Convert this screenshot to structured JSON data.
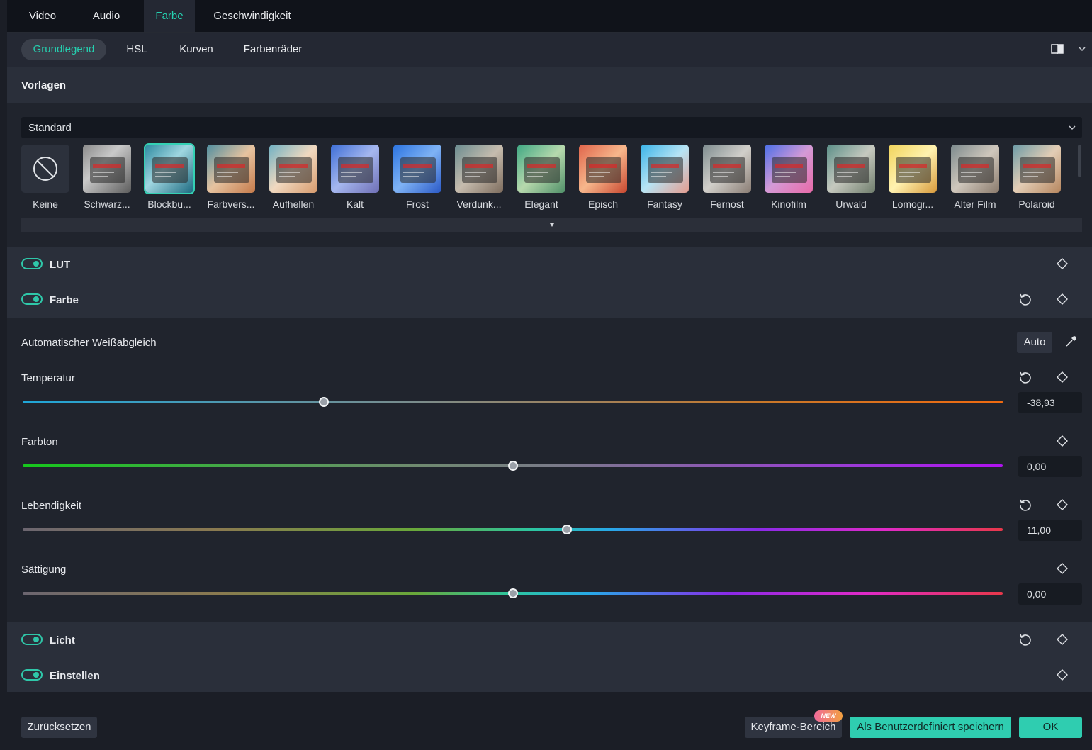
{
  "top_tabs": [
    {
      "label": "Video"
    },
    {
      "label": "Audio"
    },
    {
      "label": "Farbe"
    },
    {
      "label": "Geschwindigkeit"
    }
  ],
  "sub_tabs": [
    {
      "label": "Grundlegend"
    },
    {
      "label": "HSL"
    },
    {
      "label": "Kurven"
    },
    {
      "label": "Farbenräder"
    }
  ],
  "presets_section": {
    "title": "Vorlagen",
    "dropdown_value": "Standard",
    "items": [
      {
        "label": "Keine"
      },
      {
        "label": "Schwarz..."
      },
      {
        "label": "Blockbu..."
      },
      {
        "label": "Farbvers..."
      },
      {
        "label": "Aufhellen"
      },
      {
        "label": "Kalt"
      },
      {
        "label": "Frost"
      },
      {
        "label": "Verdunk..."
      },
      {
        "label": "Elegant"
      },
      {
        "label": "Episch"
      },
      {
        "label": "Fantasy"
      },
      {
        "label": "Fernost"
      },
      {
        "label": "Kinofilm"
      },
      {
        "label": "Urwald"
      },
      {
        "label": "Lomogr..."
      },
      {
        "label": "Alter Film"
      },
      {
        "label": "Polaroid"
      }
    ],
    "selected": "Blockbu..."
  },
  "lut": {
    "label": "LUT",
    "enabled": true
  },
  "color": {
    "label": "Farbe",
    "enabled": true,
    "white_balance_label": "Automatischer Weißabgleich",
    "auto_button": "Auto",
    "sliders": [
      {
        "label": "Temperatur",
        "value": "-38,93",
        "position": 0.307
      },
      {
        "label": "Farbton",
        "value": "0,00",
        "position": 0.5
      },
      {
        "label": "Lebendigkeit",
        "value": "11,00",
        "position": 0.555
      },
      {
        "label": "Sättigung",
        "value": "0,00",
        "position": 0.5
      }
    ]
  },
  "light": {
    "label": "Licht",
    "enabled": true
  },
  "adjust": {
    "label": "Einstellen",
    "enabled": true
  },
  "footer": {
    "reset_label": "Zurücksetzen",
    "keyframe_label": "Keyframe-Bereich",
    "new_badge": "NEW",
    "save_custom_label": "Als Benutzerdefiniert speichern",
    "ok_label": "OK"
  },
  "colors": {
    "accent": "#25d0b0",
    "panel": "#242833",
    "background": "#1b1e26"
  }
}
